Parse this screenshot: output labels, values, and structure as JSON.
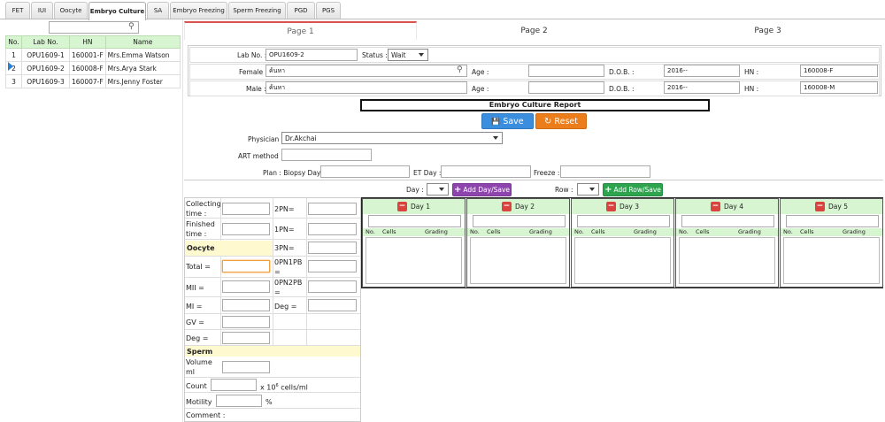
{
  "top_tabs": [
    "FET",
    "IUI",
    "Oocyte",
    "Embryo Culture",
    "SA",
    "Embryo Freezing",
    "Sperm Freezing",
    "PGD",
    "PGS"
  ],
  "active_tab": "Embryo Culture",
  "patient_table": {
    "headers": [
      "No.",
      "Lab No.",
      "HN",
      "Name"
    ],
    "rows": [
      {
        "no": "1",
        "lab_no": "OPU1609-1",
        "hn": "160001-F",
        "name": "Mrs.Emma Watson"
      },
      {
        "no": "2",
        "lab_no": "OPU1609-2",
        "hn": "160008-F",
        "name": "Mrs.Arya Stark"
      },
      {
        "no": "3",
        "lab_no": "OPU1609-3",
        "hn": "160007-F",
        "name": "Mrs.Jenny Foster"
      }
    ]
  },
  "page_tabs": [
    "Page 1",
    "Page 2",
    "Page 3"
  ],
  "header": {
    "lab_no_label": "Lab No. :",
    "lab_no_value": "OPU1609-2",
    "status_label": "Status :",
    "status_value": "Wait",
    "female_label": "Female :",
    "female_value": "ค้นหา",
    "male_label": "Male :",
    "male_value": "ค้นหา",
    "age_label": "Age :",
    "dob_label": "D.O.B. :",
    "female_dob": "2016--",
    "male_dob": "2016--",
    "hn_label": "HN :",
    "female_hn": "160008-F",
    "male_hn": "160008-M"
  },
  "report_title": "Embryo Culture Report",
  "buttons": {
    "save": "Save",
    "reset": "Reset",
    "add_day": "Add Day/Save",
    "add_row": "Add Row/Save"
  },
  "form": {
    "physician_label": "Physician :",
    "physician_value": "Dr.Akchai",
    "art_method_label": "ART method :",
    "plan_label": "Plan : Biopsy Day :",
    "et_day_label": "ET Day :",
    "freeze_label": "Freeze :",
    "day_label": "Day :",
    "row_label": "Row :"
  },
  "oocyte": {
    "collecting_time": "Collecting time :",
    "finished_time": "Finished time :",
    "oocyte_header": "Oocyte",
    "total": "Total =",
    "mii": "MII =",
    "mi": "MI =",
    "gv": "GV =",
    "deg": "Deg =",
    "pn2": "2PN=",
    "pn1": "1PN=",
    "pn3": "3PN=",
    "opn1pb": "0PN1PB =",
    "opn2pb": "0PN2PB =",
    "deg2": "Deg ="
  },
  "sperm": {
    "header": "Sperm",
    "volume": "Volume ml",
    "count": "Count",
    "count_unit": "x 10",
    "count_exp": "6",
    "count_unit2": " cells/ml",
    "motility": "Motility",
    "motility_unit": "%",
    "comment": "Comment :"
  },
  "days": [
    {
      "label": "Day 1",
      "cols": [
        "No.",
        "Cells",
        "Grading"
      ]
    },
    {
      "label": "Day 2",
      "cols": [
        "No.",
        "Cells",
        "Grading"
      ]
    },
    {
      "label": "Day 3",
      "cols": [
        "No.",
        "Cells",
        "Grading"
      ]
    },
    {
      "label": "Day 4",
      "cols": [
        "No.",
        "Cells",
        "Grading"
      ]
    },
    {
      "label": "Day 5",
      "cols": [
        "No.",
        "Cells",
        "Grading"
      ]
    }
  ],
  "colors": {
    "green_header": "#d7f5d0",
    "save_blue": "#3b8ede",
    "reset_orange": "#ec7d1b",
    "accent_red": "#d9534f"
  }
}
